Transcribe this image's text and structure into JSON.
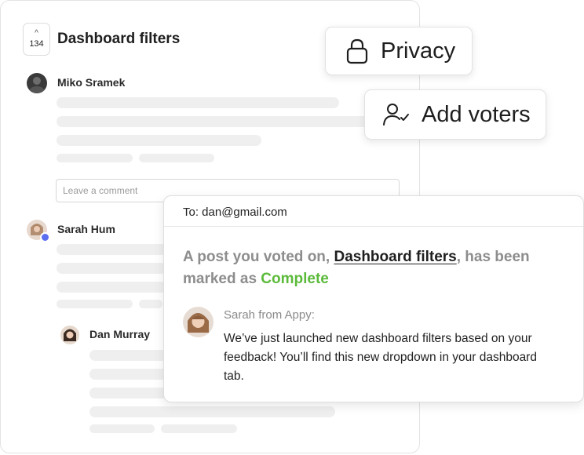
{
  "post": {
    "vote_count": "134",
    "title": "Dashboard filters",
    "comments": [
      {
        "author": "Miko Sramek"
      },
      {
        "author": "Sarah Hum"
      },
      {
        "author": "Dan Murray"
      }
    ],
    "comment_placeholder": "Leave a comment"
  },
  "actions": {
    "privacy_label": "Privacy",
    "privacy_icon": "lock-icon",
    "add_voters_label": "Add voters",
    "add_voters_icon": "user-check-icon"
  },
  "email": {
    "to": "To: dan@gmail.com",
    "headline_prefix": "A post you voted on, ",
    "headline_link": "Dashboard filters",
    "headline_middle": ", has been marked as ",
    "headline_status": "Complete",
    "status_color": "#5cba3b",
    "sender": "Sarah from Appy:",
    "message": "We’ve just launched new dashboard filters based on your feedback! You’ll find this new dropdown in your dashboard tab."
  }
}
